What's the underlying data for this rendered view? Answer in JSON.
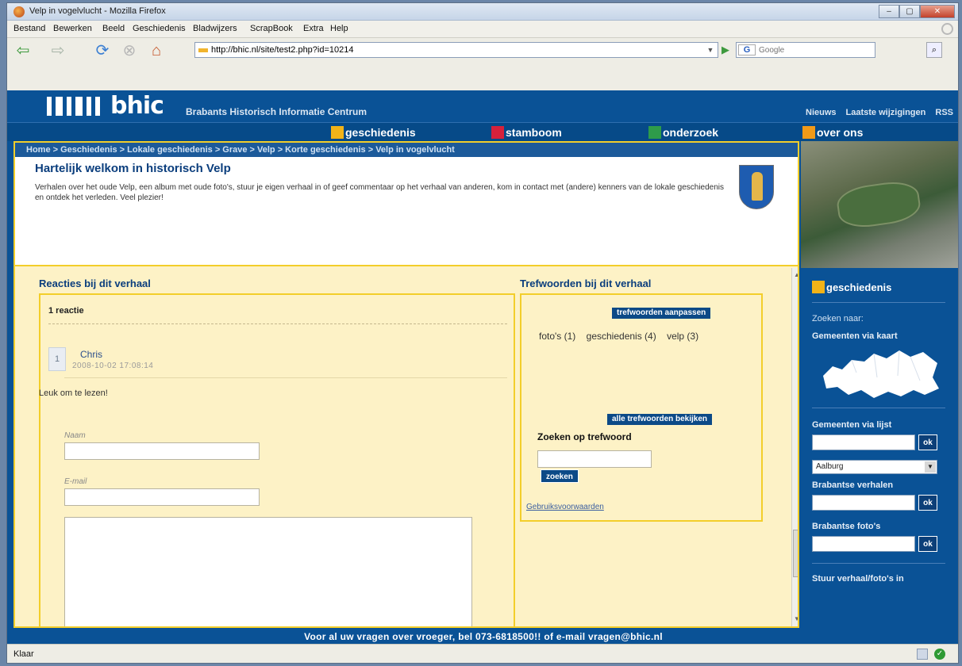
{
  "window": {
    "title": "Velp in vogelvlucht - Mozilla Firefox",
    "buttons": [
      "–",
      "▢",
      "✕"
    ]
  },
  "menu": [
    "Bestand",
    "Bewerken",
    "Beeld",
    "Geschiedenis",
    "Bladwijzers",
    "ScrapBook",
    "Extra",
    "Help"
  ],
  "toolbar": {
    "url": "http://bhic.nl/site/test2.php?id=10214",
    "search_placeholder": "Google",
    "search_engine": "G"
  },
  "site": {
    "logo": "bhic",
    "subtitle": "Brabants Historisch Informatie Centrum",
    "toplinks": [
      "Nieuws",
      "Laatste wijzigingen",
      "RSS"
    ],
    "nav": [
      {
        "label": "geschiedenis",
        "color": "#f2b318"
      },
      {
        "label": "stamboom",
        "color": "#d6213b"
      },
      {
        "label": "onderzoek",
        "color": "#2e9b4a"
      },
      {
        "label": "over ons",
        "color": "#f29a18"
      }
    ],
    "breadcrumb": "Home > Geschiedenis > Lokale geschiedenis > Grave > Velp > Korte geschiedenis > Velp in vogelvlucht",
    "welcome_title": "Hartelijk welkom in historisch Velp",
    "welcome_text": "Verhalen over het oude Velp, een album met oude foto's, stuur je eigen verhaal in of geef commentaar op het verhaal van anderen, kom in contact met (andere) kenners van de lokale geschiedenis en ontdek het verleden. Veel plezier!"
  },
  "reacties": {
    "title": "Reacties bij dit verhaal",
    "count": "1 reactie",
    "comment": {
      "num": "1",
      "author": "Chris",
      "date": "2008-10-02 17:08:14",
      "text": "Leuk om te lezen!"
    },
    "form": {
      "naam_label": "Naam",
      "email_label": "E-mail"
    }
  },
  "trefwoorden": {
    "title": "Trefwoorden bij dit verhaal",
    "edit_button": "trefwoorden aanpassen",
    "tags": [
      "foto's (1)",
      "geschiedenis (4)",
      "velp (3)"
    ],
    "all_button": "alle trefwoorden bekijken",
    "search_title": "Zoeken op trefwoord",
    "search_button": "zoeken",
    "terms_link": "Gebruiksvoorwaarden"
  },
  "sidebar": {
    "title": "geschiedenis",
    "zoeken": "Zoeken naar:",
    "kaart": "Gemeenten via kaart",
    "lijst": "Gemeenten via lijst",
    "ok": "ok",
    "select_value": "Aalburg",
    "verhalen": "Brabantse verhalen",
    "fotos": "Brabantse foto's",
    "stuur": "Stuur verhaal/foto's in"
  },
  "footer": "Voor al uw vragen over vroeger, bel 073-6818500!! of e-mail vragen@bhic.nl",
  "status": "Klaar"
}
